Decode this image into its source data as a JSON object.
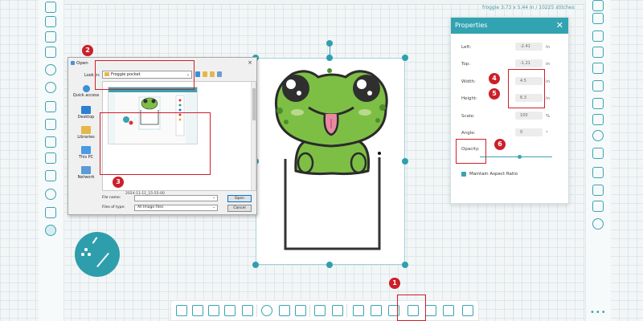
{
  "status": {
    "stitch_info": "froggie  3.73 x 5.44 in / 10225 stitches"
  },
  "open_dialog": {
    "title": "Open",
    "look_in_label": "Look in:",
    "look_in_value": "Froggie pocket",
    "places": [
      {
        "label": "Quick access",
        "icon": "star-icon"
      },
      {
        "label": "Desktop",
        "icon": "desktop-icon"
      },
      {
        "label": "Libraries",
        "icon": "libraries-icon"
      },
      {
        "label": "This PC",
        "icon": "computer-icon"
      },
      {
        "label": "Network",
        "icon": "network-icon"
      }
    ],
    "thumbnail_caption": "2024-11-11_15-55-00",
    "file_name_label": "File name:",
    "file_name_value": "",
    "file_type_label": "Files of type:",
    "file_type_value": "All Image Files",
    "open_button": "Open",
    "cancel_button": "Cancel"
  },
  "properties": {
    "title": "Properties",
    "left_label": "Left:",
    "left_value": "-2.41",
    "left_unit": "in",
    "top_label": "Top:",
    "top_value": "-1.21",
    "top_unit": "in",
    "width_label": "Width:",
    "width_value": "4.5",
    "width_unit": "in",
    "height_label": "Height:",
    "height_value": "6.3",
    "height_unit": "in",
    "scale_label": "Scale:",
    "scale_value": "100",
    "scale_unit": "%",
    "angle_label": "Angle:",
    "angle_value": "0",
    "angle_unit": "°",
    "opacity_label": "Opacity:",
    "opacity_fraction": 0.55,
    "aspect_label": "Maintain Aspect Ratio",
    "aspect_checked": true
  },
  "annotations": {
    "n1": "1",
    "n2": "2",
    "n3": "3",
    "n4": "4",
    "n5": "5",
    "n6": "6"
  },
  "colors": {
    "accent": "#32a3b1",
    "annotation": "#cc1f2a",
    "frog_green": "#7dbf45"
  },
  "toolbar_icons": [
    "select-icon",
    "transform-icon",
    "node-edit-icon",
    "knife-icon",
    "crop-icon",
    "zoom-icon",
    "pan-hand-icon",
    "measure-icon",
    "fit-icon",
    "resize-icon",
    "group-icon",
    "align-icon",
    "mirror-icon",
    "add-image-icon",
    "image-edit-icon",
    "trace-icon",
    "preview-icon"
  ]
}
